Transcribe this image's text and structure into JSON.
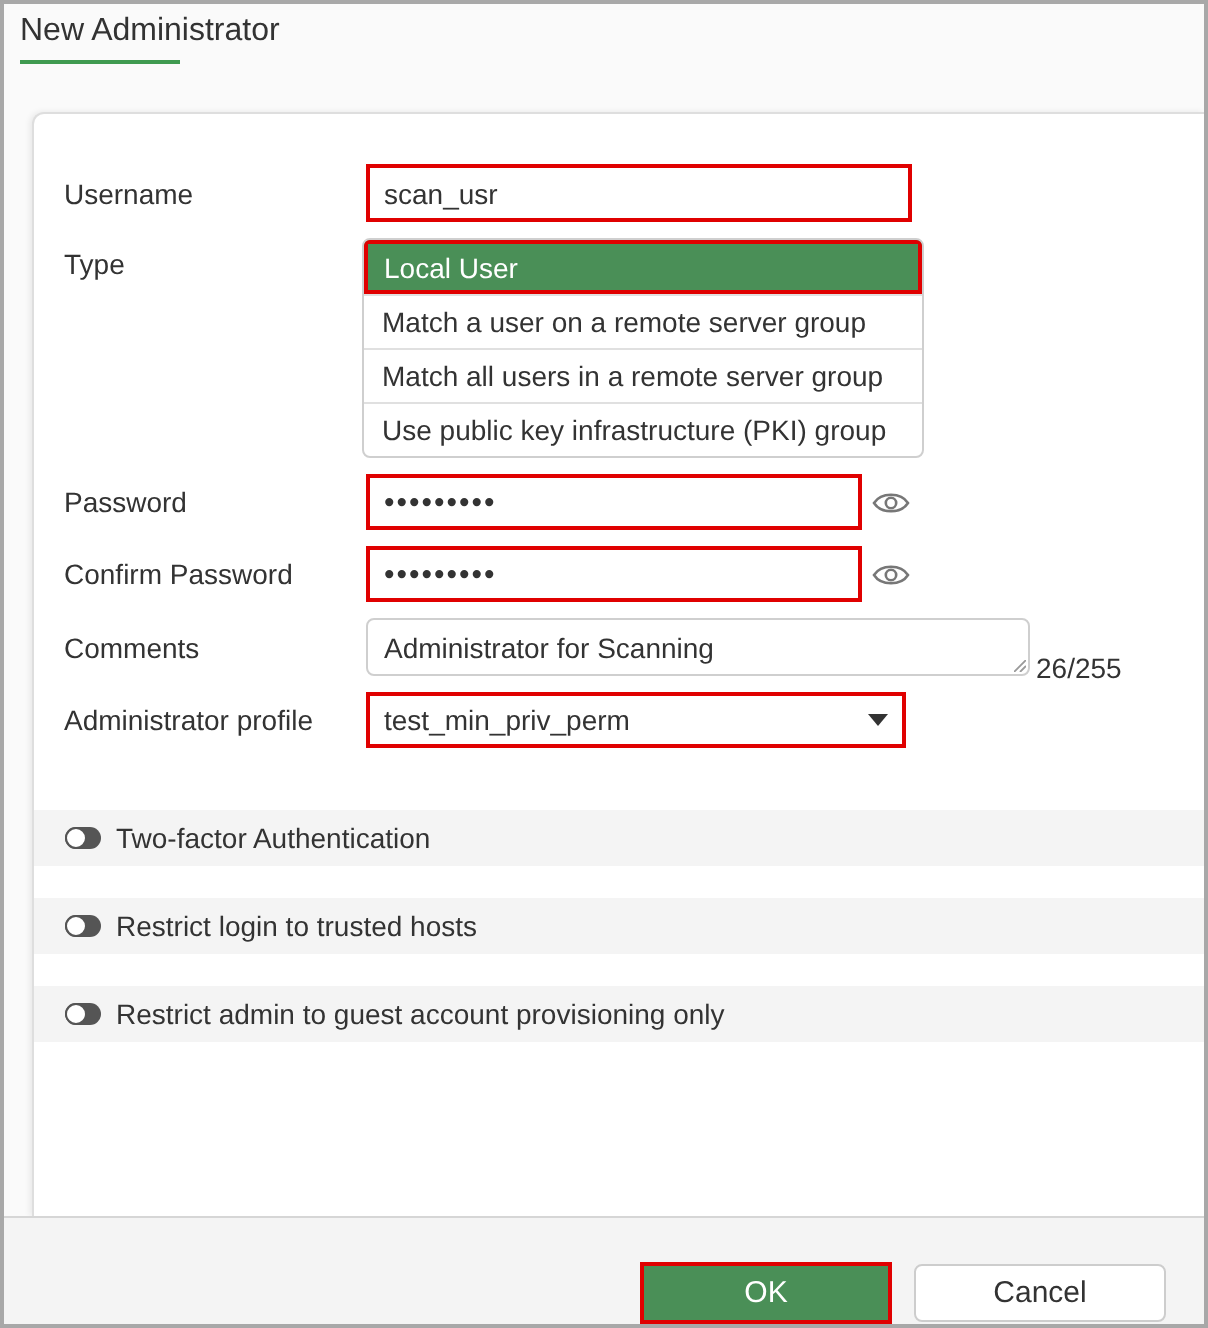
{
  "window": {
    "title": "New Administrator"
  },
  "form": {
    "fields": [
      {
        "kind": "text",
        "label": "Username",
        "value": "scan_usr",
        "highlighted": true
      },
      {
        "kind": "choice",
        "label": "Type",
        "options": [
          {
            "label": "Local User",
            "selected": true,
            "highlighted": true
          },
          {
            "label": "Match a user on a remote server group",
            "selected": false,
            "highlighted": false
          },
          {
            "label": "Match all users in a remote server group",
            "selected": false,
            "highlighted": false
          },
          {
            "label": "Use public key infrastructure (PKI) group",
            "selected": false,
            "highlighted": false
          }
        ]
      },
      {
        "kind": "password",
        "label": "Password",
        "value": "•••••••••",
        "highlighted": true
      },
      {
        "kind": "password",
        "label": "Confirm Password",
        "value": "•••••••••",
        "highlighted": true
      },
      {
        "kind": "textarea",
        "label": "Comments",
        "value": "Administrator for Scanning",
        "counter": "26/255",
        "highlighted": false
      },
      {
        "kind": "select",
        "label": "Administrator profile",
        "value": "test_min_priv_perm",
        "highlighted": true
      }
    ]
  },
  "sections": [
    {
      "label": "Two-factor Authentication",
      "on": false
    },
    {
      "label": "Restrict login to trusted hosts",
      "on": false
    },
    {
      "label": "Restrict admin to guest account provisioning only",
      "on": false
    }
  ],
  "buttons": [
    {
      "kind": "primary",
      "label": "OK",
      "highlighted": true
    },
    {
      "kind": "secondary",
      "label": "Cancel",
      "highlighted": false
    }
  ]
}
